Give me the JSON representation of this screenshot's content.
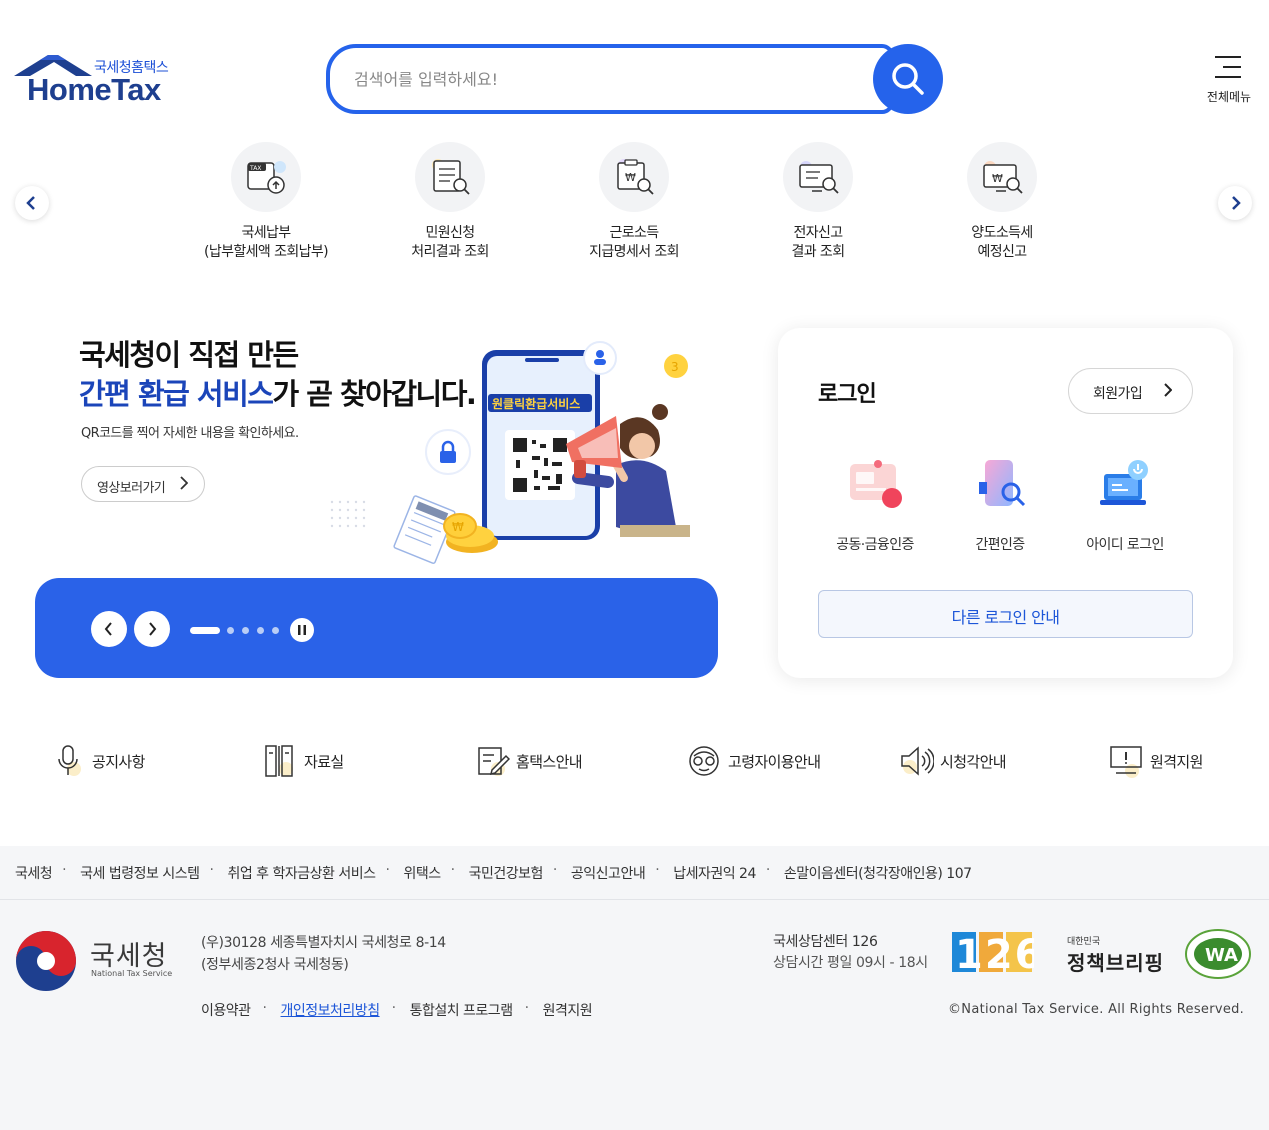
{
  "header": {
    "logo_sub": "국세청홈택스",
    "logo_main": "HomeTax",
    "search_placeholder": "검색어를 입력하세요!",
    "menu_label": "전체메뉴"
  },
  "quick_menu": [
    {
      "line1": "국세납부",
      "line2": "(납부할세액 조회납부)",
      "icon": "tax-payment-icon"
    },
    {
      "line1": "민원신청",
      "line2": "처리결과 조회",
      "icon": "civil-petition-icon"
    },
    {
      "line1": "근로소득",
      "line2": "지급명세서 조회",
      "icon": "earned-income-icon"
    },
    {
      "line1": "전자신고",
      "line2": "결과 조회",
      "icon": "e-filing-icon"
    },
    {
      "line1": "양도소득세",
      "line2": "예정신고",
      "icon": "capital-gains-icon"
    }
  ],
  "banner": {
    "title_line1": "국세청이 직접 만든",
    "title_line2_highlight": "간편 환급 서비스",
    "title_line2_rest": "가 곧 찾아갑니다.",
    "subtitle": "QR코드를 찍어 자세한 내용을 확인하세요.",
    "video_button": "영상보러가기",
    "phone_label": "원클릭환급서비스",
    "slide_count": 5,
    "active_slide": 1
  },
  "login": {
    "title": "로그인",
    "join_label": "회원가입",
    "options": [
      {
        "label": "공동·금융인증",
        "icon": "certificate-icon"
      },
      {
        "label": "간편인증",
        "icon": "simple-auth-icon"
      },
      {
        "label": "아이디 로그인",
        "icon": "id-login-icon"
      }
    ],
    "other_login": "다른 로그인 안내"
  },
  "shortcuts": [
    {
      "label": "공지사항",
      "icon": "microphone-icon"
    },
    {
      "label": "자료실",
      "icon": "archive-icon"
    },
    {
      "label": "홈택스안내",
      "icon": "guide-icon"
    },
    {
      "label": "고령자이용안내",
      "icon": "senior-icon"
    },
    {
      "label": "시청각안내",
      "icon": "speaker-icon"
    },
    {
      "label": "원격지원",
      "icon": "remote-support-icon"
    }
  ],
  "footer": {
    "links": [
      "국세청",
      "국세 법령정보 시스템",
      "취업 후 학자금상환 서비스",
      "위택스",
      "국민건강보험",
      "공익신고안내",
      "납세자권익 24",
      "손말이음센터(청각장애인용) 107"
    ],
    "org_name": "국세청",
    "org_en": "National Tax Service",
    "address1": "(우)30128 세종특별자치시 국세청로 8-14",
    "address2": "(정부세종2청사 국세청동)",
    "bottom_links": [
      "이용약관",
      "개인정보처리방침",
      "통합설치 프로그램",
      "원격지원"
    ],
    "call_center": "국세상담센터 126",
    "call_hours": "상담시간 평일 09시 - 18시",
    "badge_126": "126",
    "policy_small": "대한민국",
    "policy_big": "정책브리핑",
    "wa_label": "WA",
    "copyright": "©National Tax Service. All Rights Reserved."
  },
  "colors": {
    "primary": "#2563eb",
    "navy": "#1e3f8f",
    "banner_bar": "#2a62e8"
  }
}
